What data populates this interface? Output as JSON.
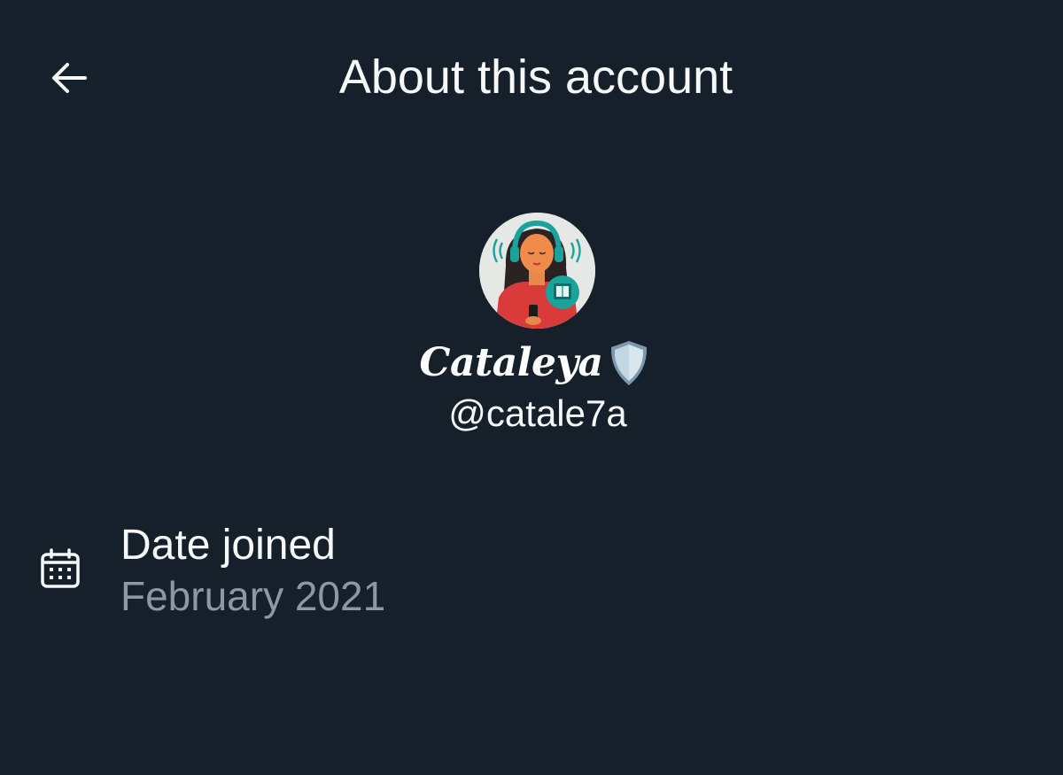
{
  "header": {
    "back_icon": "arrow-left-icon",
    "title": "About this account"
  },
  "profile": {
    "avatar_icon": "avatar-illustration",
    "display_name": "Cataleya",
    "badge_icon": "shield-icon",
    "handle": "@catale7a"
  },
  "details": {
    "date_joined": {
      "icon": "calendar-icon",
      "label": "Date joined",
      "value": "February 2021"
    }
  },
  "colors": {
    "background": "#15202b",
    "primary_text": "#f7f9f9",
    "secondary_text": "#8b98a5",
    "avatar_teal": "#1aa39a",
    "avatar_red": "#d93a3a"
  }
}
